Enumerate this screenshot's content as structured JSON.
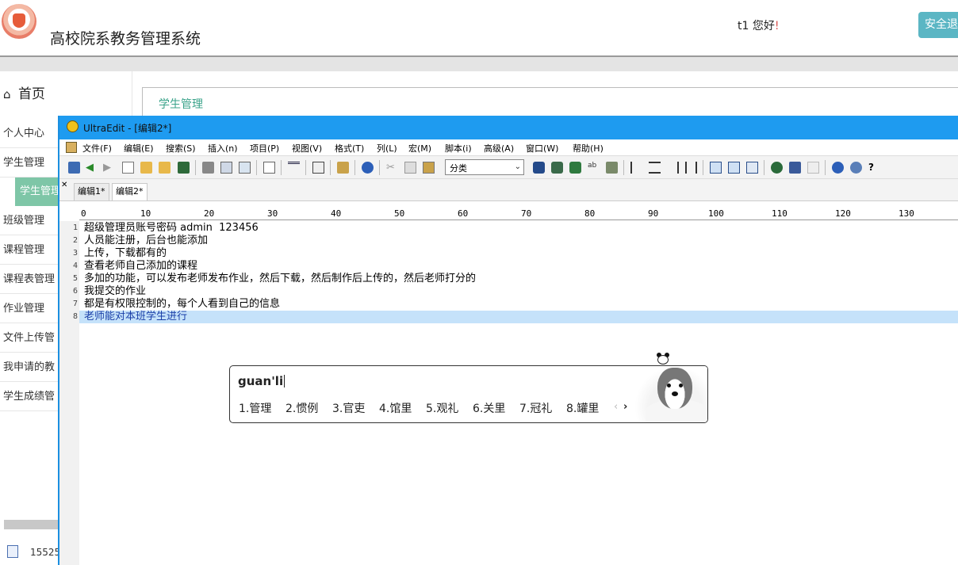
{
  "web": {
    "site_title": "高校院系教务管理系统",
    "greeting_user": "t1 您好",
    "greeting_mark": "!",
    "logout_label": "安全退出",
    "home_label": "首页",
    "content_title": "学生管理",
    "sidebar_items": [
      "个人中心",
      "学生管理",
      "班级管理",
      "课程管理",
      "课程表管理",
      "作业管理",
      "文件上传管",
      "我申请的教",
      "学生成绩管"
    ],
    "sidebar_active": "学生管理",
    "status_file_num": "15525",
    "colors": {
      "accent_green": "#7ec6a7",
      "logout_bg": "#5bb6c4"
    }
  },
  "ultraedit": {
    "title": "UltraEdit - [编辑2*]",
    "menu": [
      "文件(F)",
      "编辑(E)",
      "搜索(S)",
      "插入(n)",
      "项目(P)",
      "视图(V)",
      "格式(T)",
      "列(L)",
      "宏(M)",
      "脚本(i)",
      "高级(A)",
      "窗口(W)",
      "帮助(H)"
    ],
    "toolbar_combo": "分类",
    "tabs": [
      "编辑1*",
      "编辑2*"
    ],
    "active_tab": "编辑2*",
    "ruler": [
      "0",
      "10",
      "20",
      "30",
      "40",
      "50",
      "60",
      "70",
      "80",
      "90",
      "100",
      "110",
      "120",
      "130"
    ],
    "lines": [
      "超级管理员账号密码 admin  123456",
      "人员能注册，后台也能添加",
      "上传，下载都有的",
      "查看老师自己添加的课程",
      "多加的功能，可以发布老师发布作业，然后下载，然后制作后上传的，然后老师打分的",
      "我提交的作业",
      "都是有权限控制的，每个人看到自己的信息",
      "老师能对本班学生进行"
    ],
    "line_numbers": [
      "1",
      "2",
      "3",
      "4",
      "5",
      "6",
      "7",
      "8"
    ],
    "colors": {
      "titlebar": "#1e9bf0",
      "active_line": "#c5e2fa"
    }
  },
  "ime": {
    "composition": "guan'li",
    "candidates": [
      "1.管理",
      "2.惯例",
      "3.官吏",
      "4.馆里",
      "5.观礼",
      "6.关里",
      "7.冠礼",
      "8.罐里"
    ],
    "prev_icon": "chevron-left-icon",
    "next_icon": "chevron-right-icon"
  }
}
